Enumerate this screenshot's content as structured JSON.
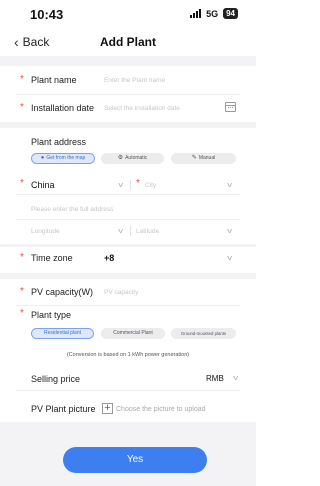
{
  "status": {
    "time": "10:43",
    "network": "5G",
    "battery": "94"
  },
  "nav": {
    "back_label": "Back",
    "title": "Add Plant"
  },
  "plant_name": {
    "label": "Plant name",
    "placeholder": "Enter the Plant name"
  },
  "installation_date": {
    "label": "Installation date",
    "placeholder": "Select the installation date"
  },
  "address": {
    "label": "Plant address",
    "modes": [
      "Get from the map",
      "Automatic",
      "Manual"
    ],
    "country": "China",
    "city_placeholder": "City",
    "full_address_placeholder": "Please enter the full address",
    "longitude_placeholder": "Longitude",
    "latitude_placeholder": "Latitude"
  },
  "time_zone": {
    "label": "Time zone",
    "value": "+8"
  },
  "pv_capacity": {
    "label": "PV capacity(W)",
    "placeholder": "PV capacity"
  },
  "plant_type": {
    "label": "Plant type",
    "options": [
      "Residential plant",
      "Commercial Plant",
      "Ground-mounted plants"
    ],
    "selected": "Residential plant",
    "note": "(Conversion is based on 1 kWh power generation)"
  },
  "selling_price": {
    "label": "Selling price",
    "currency": "RMB"
  },
  "picture": {
    "label": "PV Plant picture",
    "hint": "Choose the picture to upload"
  },
  "confirm_label": "Yes",
  "colors": {
    "accent": "#3d7ff0",
    "required": "#e34d4d",
    "chip_active_bg": "#dfe8fb"
  }
}
